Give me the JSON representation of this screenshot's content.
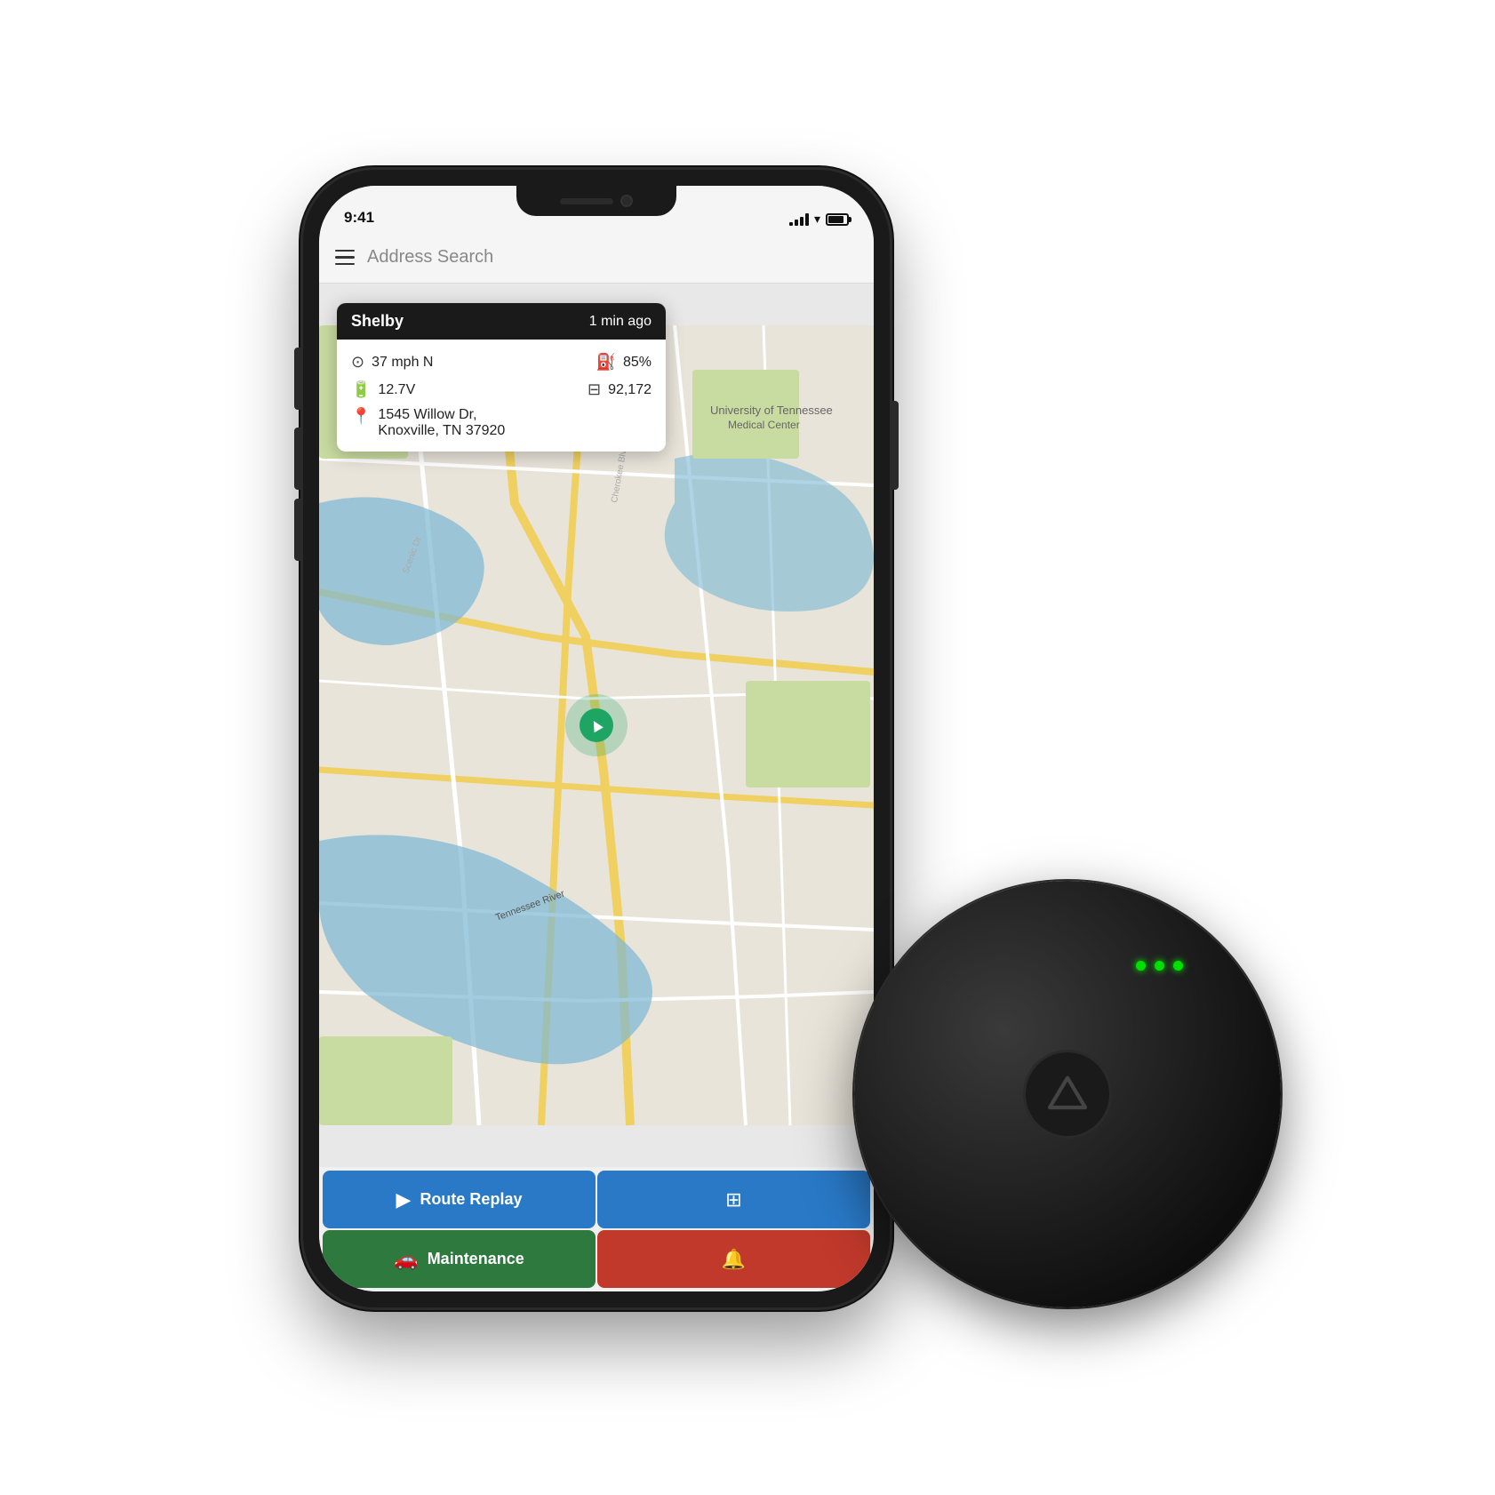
{
  "status_bar": {
    "time": "9:41"
  },
  "search_bar": {
    "placeholder": "Address Search"
  },
  "info_card": {
    "vehicle_name": "Shelby",
    "time_ago": "1 min ago",
    "speed": "37 mph N",
    "fuel": "85%",
    "voltage": "12.7V",
    "odometer": "92,172",
    "address_line1": "1545 Willow Dr,",
    "address_line2": "Knoxville, TN 37920"
  },
  "buttons": {
    "route_replay": "Route Replay",
    "maintenance": "Maintenance"
  },
  "led_count": 3
}
